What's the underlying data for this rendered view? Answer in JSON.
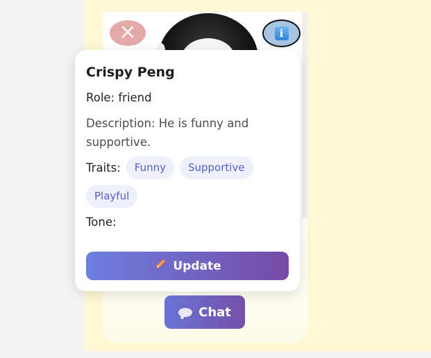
{
  "profile": {
    "name": "Crispy Peng",
    "role_text": "Role: friend",
    "description_text": "Description: He is funny and supportive.",
    "traits_label": "Traits:",
    "traits": [
      "Funny",
      "Supportive",
      "Playful"
    ],
    "tone_text": "Tone:"
  },
  "buttons": {
    "update_label": "Update",
    "update_icon": "pencil-icon",
    "chat_label": "Chat",
    "chat_icon": "speech-bubble-icon",
    "close_icon": "close-icon",
    "info_icon": "info-icon",
    "info_glyph": "i"
  },
  "colors": {
    "accent_start": "#6c7fe0",
    "accent_end": "#764ba6",
    "close_button": "#e4a9a9",
    "info_button": "#a8c4e0",
    "chip_bg": "#eef0fb",
    "chip_text": "#5460c4",
    "panel_bg": "#fef8d5"
  }
}
